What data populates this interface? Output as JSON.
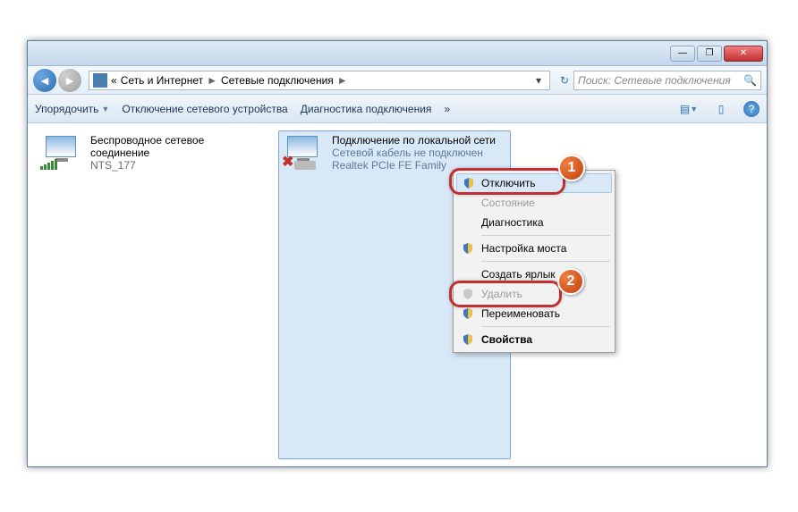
{
  "titlebar": {
    "min": "—",
    "max": "❐",
    "close": "✕"
  },
  "nav": {
    "back_arrow": "◄",
    "fwd_arrow": "►",
    "laquo": "«",
    "crumb1": "Сеть и Интернет",
    "crumb2": "Сетевые подключения",
    "sep": "►",
    "dropdown": "▾",
    "refresh": "↻",
    "search_placeholder": "Поиск: Сетевые подключения",
    "search_icon": "🔍"
  },
  "toolbar": {
    "organize": "Упорядочить",
    "disable_device": "Отключение сетевого устройства",
    "diagnose": "Диагностика подключения",
    "overflow": "»",
    "view_icon": "▤",
    "pane_icon": "▯",
    "help_icon": "?"
  },
  "connections": {
    "wifi": {
      "title": "Беспроводное сетевое соединение",
      "status": "",
      "device": "NTS_177"
    },
    "lan": {
      "title": "Подключение по локальной сети",
      "status": "Сетевой кабель не подключен",
      "device": "Realtek PCIe FE Family"
    }
  },
  "context_menu": {
    "disable": "Отключить",
    "status": "Состояние",
    "diagnose": "Диагностика",
    "bridge": "Настройка моста",
    "shortcut": "Создать ярлык",
    "delete": "Удалить",
    "rename": "Переименовать",
    "properties": "Свойства"
  },
  "callouts": {
    "n1": "1",
    "n2": "2"
  }
}
